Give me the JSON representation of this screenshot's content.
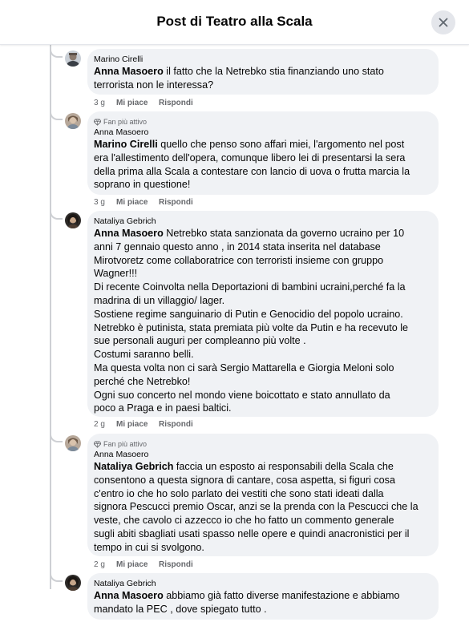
{
  "header": {
    "title": "Post di Teatro alla Scala",
    "close_icon": "close-icon"
  },
  "badge_label": "Fan più attivo",
  "comments": [
    {
      "author": "Marino Cirelli",
      "mention": "Anna Masoero",
      "text_lines": [
        " il fatto che la Netrebko stia finanziando uno stato",
        "terrorista non le interessa?"
      ],
      "time": "3 g",
      "like": "Mi piace",
      "reply": "Rispondi"
    },
    {
      "badge": true,
      "author": "Anna Masoero",
      "mention": "Marino Cirelli",
      "text_lines": [
        " quello che penso sono affari miei, l'argomento nel post",
        "era l'allestimento dell'opera, comunque libero lei di presentarsi la sera",
        "della prima alla Scala a contestare con lancio di uova o frutta marcia la",
        "soprano in questione!"
      ],
      "time": "3 g",
      "like": "Mi piace",
      "reply": "Rispondi"
    },
    {
      "author": "Nataliya Gebrich",
      "mention": "Anna Masoero",
      "text_lines": [
        " Netrebko stata sanzionata da governo ucraino per 10",
        "anni 7 gennaio questo anno , in 2014 stata inserita nel database",
        "Mirotvoretz come collaboratrice con terroristi insieme con gruppo",
        "Wagner!!!",
        "Di recente Coinvolta nella Deportazioni di bambini ucraini,perché fa la",
        "madrina di un villaggio/ lager.",
        "Sostiene regime sanguinario di Putin e Genocidio del popolo ucraino.",
        "Netrebko è putinista, stata premiata più volte da Putin e ha recevuto le",
        "sue personali auguri per compleanno più volte .",
        "Costumi saranno belli.",
        "Ma questa volta non ci sarà Sergio Mattarella e Giorgia Meloni solo",
        "perché che Netrebko!",
        "Ogni suo concerto nel mondo viene boicottato e stato annullato da",
        "poco a Praga e in paesi baltici."
      ],
      "time": "2 g",
      "like": "Mi piace",
      "reply": "Rispondi"
    },
    {
      "badge": true,
      "author": "Anna Masoero",
      "mention": "Nataliya Gebrich",
      "text_lines": [
        " faccia un esposto ai responsabili della Scala che",
        "consentono a questa signora di cantare, cosa aspetta, si figuri cosa",
        "c'entro io che ho solo parlato dei vestiti che sono stati ideati dalla",
        "signora Pescucci premio Oscar, anzi se la prenda con la Pescucci che la",
        "veste, che cavolo ci azzecco io che ho fatto un commento generale",
        "sugli abiti sbagliati usati spasso nelle opere e quindi anacronistici per il",
        "tempo in cui si svolgono."
      ],
      "time": "2 g",
      "like": "Mi piace",
      "reply": "Rispondi"
    },
    {
      "author": "Nataliya Gebrich",
      "mention": "Anna Masoero",
      "text_lines": [
        " abbiamo già fatto diverse manifestazione e abbiamo",
        "mandato la PEC , dove spiegato tutto ."
      ]
    }
  ]
}
